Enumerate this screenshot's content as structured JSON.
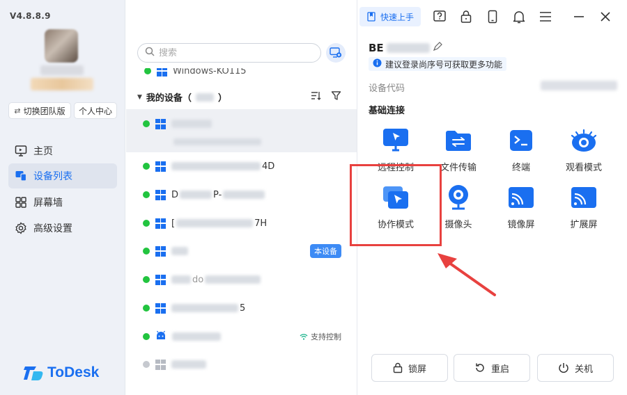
{
  "app": {
    "version": "V4.8.8.9",
    "logo_text": "ToDesk"
  },
  "sidebar": {
    "switch_team_label": "切换团队版",
    "personal_center_label": "个人中心",
    "items": [
      {
        "label": "主页",
        "icon": "monitor-icon",
        "active": false
      },
      {
        "label": "设备列表",
        "icon": "devices-icon",
        "active": true
      },
      {
        "label": "屏幕墙",
        "icon": "grid-icon",
        "active": false
      },
      {
        "label": "高级设置",
        "icon": "gear-icon",
        "active": false
      }
    ]
  },
  "device_list": {
    "search_placeholder": "搜索",
    "partial_top_device": "Windows-KO115",
    "group_title": "我的设备（",
    "group_title_end": "）",
    "devices": [
      {
        "name_prefix": "",
        "os": "windows",
        "online": true,
        "selected": true,
        "badge": ""
      },
      {
        "name_prefix": "",
        "name_suffix": "4D",
        "os": "windows",
        "online": true,
        "badge": ""
      },
      {
        "name_prefix": "D",
        "name_mid": "P-",
        "os": "windows",
        "online": true,
        "badge": ""
      },
      {
        "name_prefix": "[",
        "name_suffix": "7H",
        "os": "windows",
        "online": true,
        "badge": ""
      },
      {
        "name_prefix": "",
        "os": "windows",
        "online": true,
        "badge": "本设备"
      },
      {
        "name_prefix": "",
        "name_mid": "do",
        "os": "windows",
        "online": true,
        "badge": ""
      },
      {
        "name_prefix": "",
        "name_suffix": "5",
        "os": "windows",
        "online": true,
        "badge": ""
      },
      {
        "name_prefix": "",
        "os": "android",
        "online": true,
        "badge": "支持控制"
      },
      {
        "name_prefix": "",
        "os": "windows",
        "online": false,
        "badge": ""
      }
    ]
  },
  "topbar": {
    "quick_start_label": "快速上手"
  },
  "detail": {
    "device_title": "BE",
    "login_hint": "建议登录尚序号可获取更多功能",
    "code_label": "设备代码",
    "section_title": "基础连接",
    "tiles": [
      {
        "label": "远程控制",
        "icon": "remote-control-icon"
      },
      {
        "label": "文件传输",
        "icon": "file-transfer-icon"
      },
      {
        "label": "终端",
        "icon": "terminal-icon"
      },
      {
        "label": "观看模式",
        "icon": "eye-icon"
      },
      {
        "label": "协作模式",
        "icon": "collab-icon"
      },
      {
        "label": "摄像头",
        "icon": "camera-icon"
      },
      {
        "label": "镜像屏",
        "icon": "mirror-screen-icon"
      },
      {
        "label": "扩展屏",
        "icon": "extend-screen-icon"
      }
    ],
    "bottom_buttons": [
      {
        "label": "锁屏",
        "icon": "lock-icon"
      },
      {
        "label": "重启",
        "icon": "restart-icon"
      },
      {
        "label": "关机",
        "icon": "power-icon"
      }
    ]
  },
  "colors": {
    "accent": "#1a6ff0",
    "online": "#22c43f",
    "highlight": "#e8413f"
  }
}
